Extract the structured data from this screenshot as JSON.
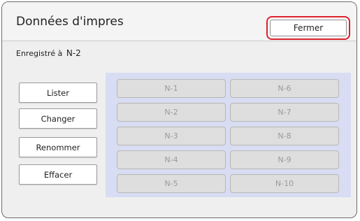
{
  "dialog": {
    "title": "Données d'impres",
    "close_label": "Fermer",
    "saved_label": "Enregistré à",
    "saved_value": "N-2"
  },
  "side_buttons": [
    {
      "label": "Lister"
    },
    {
      "label": "Changer"
    },
    {
      "label": "Renommer"
    },
    {
      "label": "Effacer"
    }
  ],
  "slots": [
    {
      "label": "N-1"
    },
    {
      "label": "N-6"
    },
    {
      "label": "N-2"
    },
    {
      "label": "N-7"
    },
    {
      "label": "N-3"
    },
    {
      "label": "N-8"
    },
    {
      "label": "N-4"
    },
    {
      "label": "N-9"
    },
    {
      "label": "N-5"
    },
    {
      "label": "N-10"
    }
  ],
  "colors": {
    "highlight": "#d9202a",
    "panel": "#d9ddf3",
    "disabled_slot": "#dedede"
  }
}
